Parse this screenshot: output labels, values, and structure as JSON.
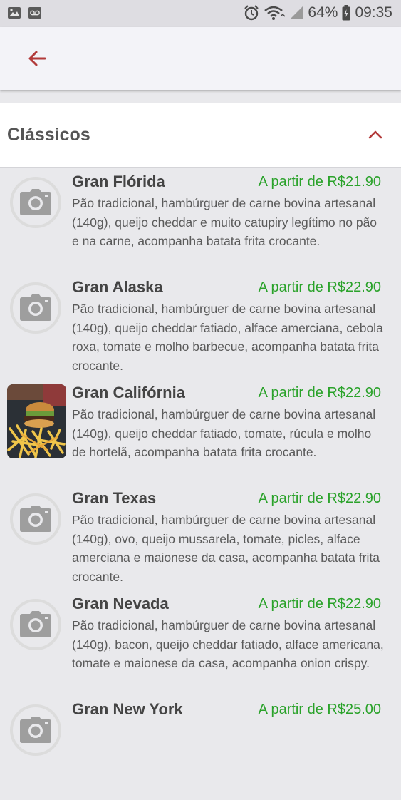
{
  "status_bar": {
    "battery": "64%",
    "time": "09:35",
    "icons": [
      "image-icon",
      "voicemail-icon",
      "alarm-icon",
      "wifi-icon",
      "signal-icon",
      "battery-icon"
    ]
  },
  "app_bar": {
    "back_icon": "arrow-left-icon",
    "accent": "#b23a3a"
  },
  "section": {
    "title": "Clássicos",
    "toggle_icon": "chevron-up-icon"
  },
  "colors": {
    "price": "#2aa22a",
    "accent": "#b23a3a"
  },
  "items": [
    {
      "name": "Gran Flórida",
      "price": "A partir de R$21.90",
      "description": "Pão tradicional, hambúrguer de carne bovina artesanal (140g), queijo cheddar e muito catupiry legítimo no pão e na carne, acompanha batata frita crocante.",
      "image": "camera-placeholder-icon"
    },
    {
      "name": "Gran Alaska",
      "price": "A partir de R$22.90",
      "description": "Pão tradicional, hambúrguer de carne bovina artesanal (140g), queijo cheddar fatiado, alface amerciana, cebola roxa, tomate e molho barbecue, acompanha batata frita crocante.",
      "image": "camera-placeholder-icon"
    },
    {
      "name": "Gran Califórnia",
      "price": "A partir de R$22.90",
      "description": "Pão tradicional, hambúrguer de carne bovina artesanal (140g), queijo cheddar fatiado, tomate, rúcula e molho de hortelã, acompanha batata frita crocante.",
      "image": "burger-photo"
    },
    {
      "name": "Gran Texas",
      "price": "A partir de R$22.90",
      "description": "Pão tradicional, hambúrguer de carne bovina artesanal (140g), ovo, queijo mussarela, tomate, picles, alface amerciana e maionese da casa, acompanha batata frita crocante.",
      "image": "camera-placeholder-icon"
    },
    {
      "name": "Gran Nevada",
      "price": "A partir de R$22.90",
      "description": "Pão tradicional, hambúrguer de carne bovina artesanal (140g), bacon, queijo cheddar fatiado, alface americana, tomate e maionese da casa, acompanha onion crispy.",
      "image": "camera-placeholder-icon"
    },
    {
      "name": "Gran New York",
      "price": "A partir de R$25.00",
      "description": "",
      "image": "camera-placeholder-icon"
    }
  ]
}
